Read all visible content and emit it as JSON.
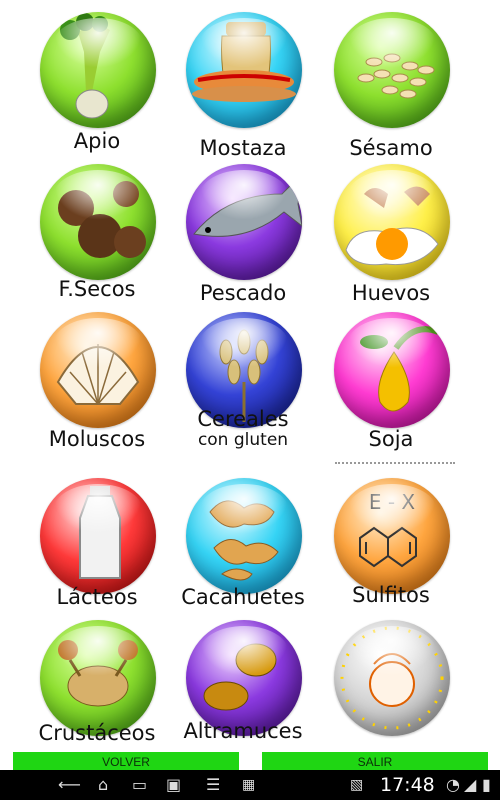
{
  "tiles": [
    {
      "id": "apio",
      "label": "Apio"
    },
    {
      "id": "mostaza",
      "label": "Mostaza"
    },
    {
      "id": "sesamo",
      "label": "Sésamo"
    },
    {
      "id": "fsecos",
      "label": "F.Secos"
    },
    {
      "id": "pescado",
      "label": "Pescado"
    },
    {
      "id": "huevos",
      "label": "Huevos"
    },
    {
      "id": "moluscos",
      "label": "Moluscos"
    },
    {
      "id": "cereales",
      "label_line1": "Cereales",
      "label_line2": "con gluten"
    },
    {
      "id": "soja",
      "label": "Soja"
    },
    {
      "id": "lacteos",
      "label": "Lácteos"
    },
    {
      "id": "cacahuetes",
      "label": "Cacahuetes"
    },
    {
      "id": "sulfitos",
      "label": "Sulfitos",
      "icon_text": "E - X"
    },
    {
      "id": "crustaceos",
      "label": "Crustáceos"
    },
    {
      "id": "altramuces",
      "label": "Altramuces"
    },
    {
      "id": "info",
      "label": ""
    }
  ],
  "buttons": {
    "volver": "VOLVER",
    "salir": "SALIR"
  },
  "status_bar": {
    "time": "17:48"
  },
  "icons": {
    "back": "back-icon",
    "home": "home-icon",
    "recents": "recent-apps-icon",
    "screenshot": "screenshot-icon",
    "menu": "menu-icon",
    "sd": "sd-card-icon",
    "image": "image-icon",
    "wifi": "wifi-icon",
    "signal": "signal-icon",
    "battery": "battery-icon"
  }
}
